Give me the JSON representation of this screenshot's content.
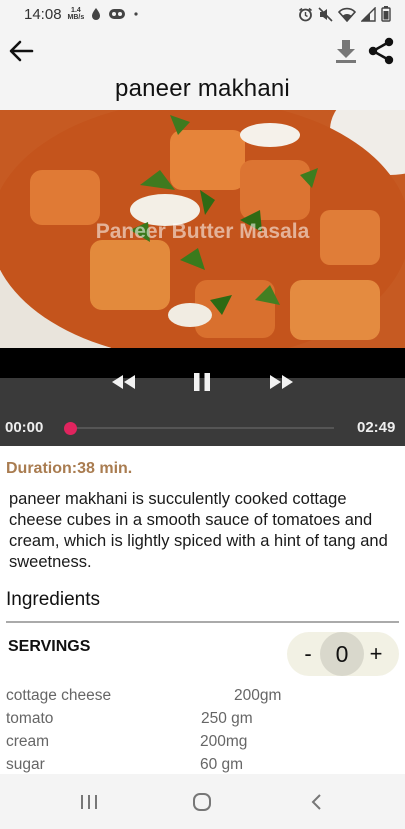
{
  "status_bar": {
    "time": "14:08",
    "speed_value": "1.4",
    "speed_unit": "MB/s",
    "icons": [
      "drop-icon",
      "circle-badge-icon",
      "dot-icon",
      "alarm-icon",
      "mute-icon",
      "wifi-icon",
      "signal-icon",
      "battery-icon"
    ]
  },
  "app_bar": {
    "title": "paneer makhani",
    "icons": [
      "back-arrow-icon",
      "download-icon",
      "share-icon"
    ]
  },
  "video": {
    "watermark": "Paneer Butter Masala",
    "current_time": "00:00",
    "total_time": "02:49",
    "progress_fraction": 0.0,
    "accent_color": "#e0245e",
    "controls": [
      "rewind-icon",
      "pause-icon",
      "fast-forward-icon"
    ]
  },
  "details": {
    "duration": "Duration:38 min.",
    "description": "paneer makhani is succulently cooked cottage cheese cubes in a smooth sauce of tomatoes and cream, which is lightly spiced with a hint of tang and sweetness."
  },
  "ingredients": {
    "heading": "Ingredients",
    "servings_label": "SERVINGS",
    "minus_label": "-",
    "servings_value": "0",
    "plus_label": "+",
    "items": [
      {
        "name": "cottage cheese",
        "qty": "200gm"
      },
      {
        "name": "tomato",
        "qty": "250 gm"
      },
      {
        "name": "cream",
        "qty": "200mg"
      },
      {
        "name": "sugar",
        "qty": "60 gm"
      }
    ]
  },
  "nav_bar": {
    "icons": [
      "recent-apps-icon",
      "home-icon",
      "back-icon"
    ]
  }
}
